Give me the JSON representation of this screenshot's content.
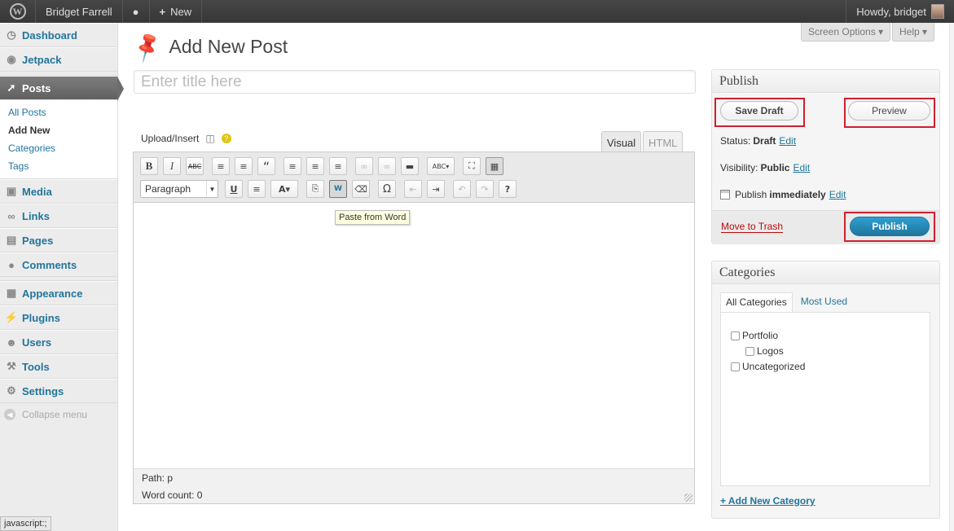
{
  "adminbar": {
    "site_name": "Bridget Farrell",
    "new_label": "New",
    "howdy": "Howdy, bridget"
  },
  "sidebar": {
    "items": [
      {
        "label": "Dashboard",
        "icon": "dashboard-icon"
      },
      {
        "label": "Jetpack",
        "icon": "jetpack-icon"
      },
      {
        "label": "Posts",
        "icon": "pin-icon"
      },
      {
        "label": "Media",
        "icon": "media-icon"
      },
      {
        "label": "Links",
        "icon": "links-icon"
      },
      {
        "label": "Pages",
        "icon": "pages-icon"
      },
      {
        "label": "Comments",
        "icon": "comments-icon"
      },
      {
        "label": "Appearance",
        "icon": "appearance-icon"
      },
      {
        "label": "Plugins",
        "icon": "plugins-icon"
      },
      {
        "label": "Users",
        "icon": "users-icon"
      },
      {
        "label": "Tools",
        "icon": "tools-icon"
      },
      {
        "label": "Settings",
        "icon": "settings-icon"
      }
    ],
    "posts_submenu": [
      "All Posts",
      "Add New",
      "Categories",
      "Tags"
    ],
    "collapse": "Collapse menu"
  },
  "screen_options": "Screen Options",
  "help": "Help",
  "page": {
    "title": "Add New Post",
    "title_placeholder": "Enter title here"
  },
  "editor": {
    "upload_insert": "Upload/Insert",
    "tab_visual": "Visual",
    "tab_html": "HTML",
    "format_select": "Paragraph",
    "tooltip": "Paste from Word",
    "path_label": "Path:",
    "path_value": "p",
    "word_count": "Word count: 0"
  },
  "publish": {
    "title": "Publish",
    "save_draft": "Save Draft",
    "preview": "Preview",
    "status_label": "Status:",
    "status_value": "Draft",
    "visibility_label": "Visibility:",
    "visibility_value": "Public",
    "schedule_label": "Publish",
    "schedule_value": "immediately",
    "edit": "Edit",
    "trash": "Move to Trash",
    "publish_button": "Publish"
  },
  "categories": {
    "title": "Categories",
    "tab_all": "All Categories",
    "tab_most_used": "Most Used",
    "items": [
      "Portfolio",
      "Logos",
      "Uncategorized"
    ],
    "add_new": "+ Add New Category"
  },
  "statusbar": "javascript:;",
  "colors": {
    "link": "#21759b",
    "highlight_box": "#d0202e",
    "primary": "#21759b",
    "trash": "#bc0b0b"
  }
}
